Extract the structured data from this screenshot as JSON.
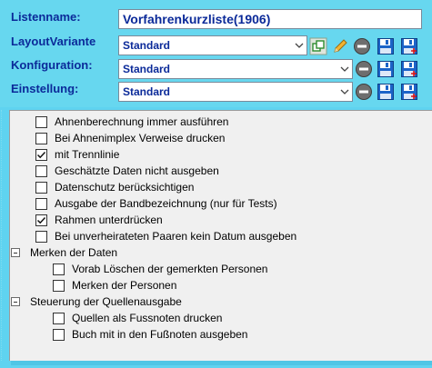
{
  "form": {
    "listenname_label": "Listenname:",
    "listenname_value": "Vorfahrenkurzliste(1906)",
    "layout_label": "LayoutVariante",
    "layout_value": "Standard",
    "konfiguration_label": "Konfiguration:",
    "konfiguration_value": "Standard",
    "einstellung_label": "Einstellung:",
    "einstellung_value": "Standard"
  },
  "icons": {
    "copy": "copy-icon",
    "edit": "pencil-icon",
    "delete": "minus-circle-icon",
    "save": "floppy-disk-icon",
    "save_as": "floppy-disk-plus-icon"
  },
  "options": {
    "items": [
      {
        "label": "Ahnenberechnung immer ausführen",
        "checked": false
      },
      {
        "label": "Bei Ahnenimplex Verweise drucken",
        "checked": false
      },
      {
        "label": "mit Trennlinie",
        "checked": true
      },
      {
        "label": "Geschätzte Daten nicht ausgeben",
        "checked": false
      },
      {
        "label": "Datenschutz berücksichtigen",
        "checked": false
      },
      {
        "label": "Ausgabe der Bandbezeichnung (nur für Tests)",
        "checked": false
      },
      {
        "label": "Rahmen unterdrücken",
        "checked": true
      },
      {
        "label": "Bei unverheirateten Paaren kein Datum ausgeben",
        "checked": false
      }
    ],
    "groups": [
      {
        "label": "Merken der Daten",
        "items": [
          {
            "label": "Vorab Löschen der gemerkten Personen",
            "checked": false
          },
          {
            "label": "Merken der Personen",
            "checked": false
          }
        ]
      },
      {
        "label": "Steuerung der Quellenausgabe",
        "items": [
          {
            "label": "Quellen als Fussnoten drucken",
            "checked": false
          },
          {
            "label": "Buch mit in den Fußnoten ausgeben",
            "checked": false
          }
        ]
      }
    ]
  },
  "colors": {
    "background": "#67d7ef",
    "label_text": "#0b2a99",
    "panel": "#f0f0f0"
  }
}
